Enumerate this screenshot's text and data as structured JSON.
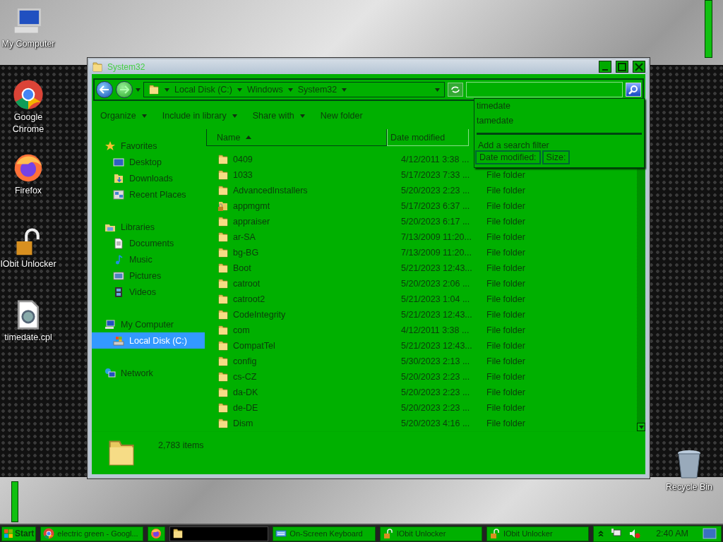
{
  "desktop_icons": [
    {
      "label": "My Computer",
      "kind": "computer"
    },
    {
      "label": "Google Chrome",
      "kind": "chrome"
    },
    {
      "label": "Firefox",
      "kind": "firefox"
    },
    {
      "label": "IObit Unlocker",
      "kind": "unlocker"
    },
    {
      "label": "timedate.cpl",
      "kind": "cpl"
    }
  ],
  "recycle_bin": {
    "label": "Recycle Bin"
  },
  "window": {
    "title": "System32",
    "address": {
      "crumbs": [
        "Local Disk (C:)",
        "Windows",
        "System32"
      ]
    },
    "toolbar": [
      {
        "label": "Organize",
        "menu": true
      },
      {
        "label": "Include in library",
        "menu": true
      },
      {
        "label": "Share with",
        "menu": true
      },
      {
        "label": "New folder",
        "menu": false
      }
    ],
    "nav": [
      {
        "label": "Favorites",
        "kind": "star",
        "selected": false,
        "children": [
          {
            "label": "Desktop",
            "kind": "desktop",
            "selected": false
          },
          {
            "label": "Downloads",
            "kind": "downloads",
            "selected": false
          },
          {
            "label": "Recent Places",
            "kind": "recent",
            "selected": false
          }
        ]
      },
      {
        "label": "Libraries",
        "kind": "library",
        "selected": false,
        "children": [
          {
            "label": "Documents",
            "kind": "document",
            "selected": false
          },
          {
            "label": "Music",
            "kind": "music",
            "selected": false
          },
          {
            "label": "Pictures",
            "kind": "pictures",
            "selected": false
          },
          {
            "label": "Videos",
            "kind": "video",
            "selected": false
          }
        ]
      },
      {
        "label": "My Computer",
        "kind": "computer",
        "selected": false,
        "children": [
          {
            "label": "Local Disk (C:)",
            "kind": "drive",
            "selected": true
          }
        ]
      },
      {
        "label": "Network",
        "kind": "network",
        "selected": false
      }
    ],
    "columns": [
      {
        "label": "Name",
        "sorted": true
      },
      {
        "label": "Date modified",
        "sorted": false
      }
    ],
    "rows": [
      {
        "name": "0409",
        "date": "4/12/2011 3:38 ...",
        "kind": "folder"
      },
      {
        "name": "1033",
        "date": "5/17/2023 7:33 ...",
        "type": "File folder",
        "kind": "folder"
      },
      {
        "name": "AdvancedInstallers",
        "date": "5/20/2023 2:23 ...",
        "type": "File folder",
        "kind": "folder"
      },
      {
        "name": "appmgmt",
        "date": "5/17/2023 6:37 ...",
        "type": "File folder",
        "kind": "locked"
      },
      {
        "name": "appraiser",
        "date": "5/20/2023 6:17 ...",
        "type": "File folder",
        "kind": "folder"
      },
      {
        "name": "ar-SA",
        "date": "7/13/2009 11:20...",
        "type": "File folder",
        "kind": "folder"
      },
      {
        "name": "bg-BG",
        "date": "7/13/2009 11:20...",
        "type": "File folder",
        "kind": "folder"
      },
      {
        "name": "Boot",
        "date": "5/21/2023 12:43...",
        "type": "File folder",
        "kind": "folder"
      },
      {
        "name": "catroot",
        "date": "5/20/2023 2:06 ...",
        "type": "File folder",
        "kind": "folder"
      },
      {
        "name": "catroot2",
        "date": "5/21/2023 1:04 ...",
        "type": "File folder",
        "kind": "folder"
      },
      {
        "name": "CodeIntegrity",
        "date": "5/21/2023 12:43...",
        "type": "File folder",
        "kind": "folder"
      },
      {
        "name": "com",
        "date": "4/12/2011 3:38 ...",
        "type": "File folder",
        "kind": "folder"
      },
      {
        "name": "CompatTel",
        "date": "5/21/2023 12:43...",
        "type": "File folder",
        "kind": "folder"
      },
      {
        "name": "config",
        "date": "5/30/2023 2:13 ...",
        "type": "File folder",
        "kind": "folder"
      },
      {
        "name": "cs-CZ",
        "date": "5/20/2023 2:23 ...",
        "type": "File folder",
        "kind": "folder"
      },
      {
        "name": "da-DK",
        "date": "5/20/2023 2:23 ...",
        "type": "File folder",
        "kind": "folder"
      },
      {
        "name": "de-DE",
        "date": "5/20/2023 2:23 ...",
        "type": "File folder",
        "kind": "folder"
      },
      {
        "name": "Dism",
        "date": "5/20/2023 4:16 ...",
        "type": "File folder",
        "kind": "folder"
      }
    ],
    "item_count": "2,783 items",
    "search": {
      "suggestions": [
        "timedate",
        "tamedate"
      ],
      "filter_hint": "Add a search filter",
      "filters": [
        "Date modified:",
        "Size:"
      ]
    }
  },
  "taskbar": {
    "start": "Start",
    "tasks": [
      {
        "label": "electric green - Googl...",
        "kind": "chrome"
      },
      {
        "kind": "firefox"
      },
      {
        "kind": "explorer"
      },
      {
        "label": "On-Screen Keyboard",
        "kind": "keyboard"
      },
      {
        "label": "IObit Unlocker",
        "kind": "unlocker"
      },
      {
        "label": "IObit Unlocker",
        "kind": "unlocker"
      }
    ],
    "clock": "2:40 AM"
  }
}
